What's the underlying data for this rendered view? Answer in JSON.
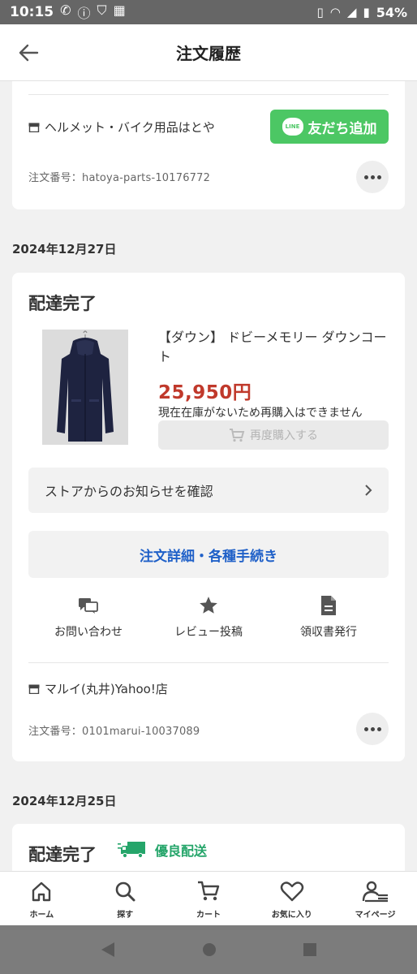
{
  "status_bar": {
    "time": "10:15",
    "battery": "54%"
  },
  "header": {
    "title": "注文履歴"
  },
  "orders": [
    {
      "store": "ヘルメット・バイク用品はとや",
      "order_no": "注文番号：hatoya-parts-10176772",
      "line_button": "友だち追加",
      "line_logo": "LINE"
    },
    {
      "date": "2024年12月27日",
      "status": "配達完了",
      "product_name": "【ダウン】 ドビーメモリー ダウンコート",
      "price": "25,950円",
      "stock_note": "現在在庫がないため再購入はできません",
      "rebuy_label": "再度購入する",
      "notice_label": "ストアからのお知らせを確認",
      "detail_label": "注文詳細・各種手続き",
      "actions": [
        {
          "label": "お問い合わせ",
          "icon": "chat-icon"
        },
        {
          "label": "レビュー投稿",
          "icon": "star-icon"
        },
        {
          "label": "領収書発行",
          "icon": "document-icon"
        }
      ],
      "store": "マルイ(丸井)Yahoo!店",
      "order_no": "注文番号：0101marui-10037089"
    },
    {
      "date": "2024年12月25日",
      "status": "配達完了",
      "delivery_badge": "優良配送"
    }
  ],
  "bottom_nav": [
    {
      "label": "ホーム",
      "icon": "home-icon"
    },
    {
      "label": "探す",
      "icon": "search-icon"
    },
    {
      "label": "カート",
      "icon": "cart-icon"
    },
    {
      "label": "お気に入り",
      "icon": "heart-icon"
    },
    {
      "label": "マイページ",
      "icon": "profile-icon"
    }
  ],
  "colors": {
    "accent_blue": "#1f60c8",
    "price_red": "#c0392b",
    "line_green": "#4cc764",
    "delivery_green": "#25a56a"
  }
}
